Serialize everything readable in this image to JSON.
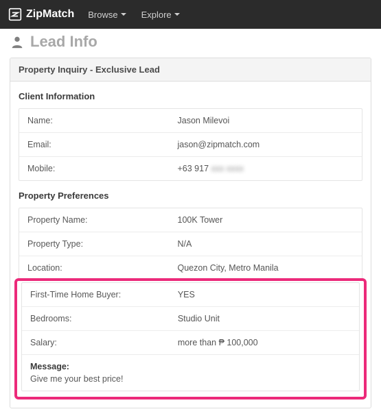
{
  "navbar": {
    "brand": "ZipMatch",
    "items": [
      "Browse",
      "Explore"
    ]
  },
  "page": {
    "title": "Lead Info"
  },
  "panel": {
    "heading": "Property Inquiry - Exclusive Lead"
  },
  "client_info": {
    "title": "Client Information",
    "rows": [
      {
        "label": "Name:",
        "value": "Jason Milevoi"
      },
      {
        "label": "Email:",
        "value": "jason@zipmatch.com"
      },
      {
        "label": "Mobile:",
        "value": "+63 917",
        "value_blurred": "xxx xxxx"
      }
    ]
  },
  "prefs": {
    "title": "Property Preferences",
    "rows_top": [
      {
        "label": "Property Name:",
        "value": "100K Tower"
      },
      {
        "label": "Property Type:",
        "value": "N/A"
      },
      {
        "label": "Location:",
        "value": "Quezon City, Metro Manila"
      }
    ],
    "rows_highlight": [
      {
        "label": "First-Time Home Buyer:",
        "value": "YES"
      },
      {
        "label": "Bedrooms:",
        "value": "Studio Unit"
      },
      {
        "label": "Salary:",
        "value": "more than ₱ 100,000"
      }
    ],
    "message": {
      "label": "Message:",
      "value": "Give me your best price!"
    }
  }
}
